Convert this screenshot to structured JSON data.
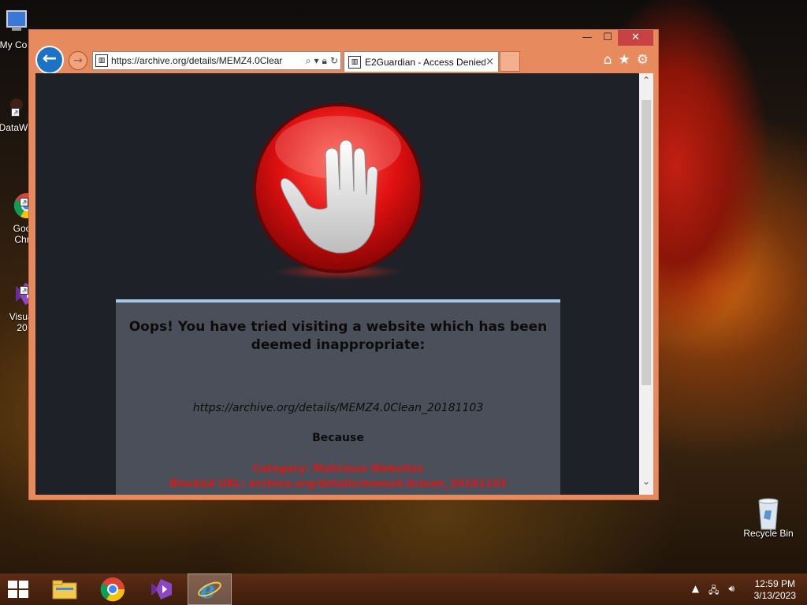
{
  "desktop": {
    "icons": [
      {
        "label": "My Co"
      },
      {
        "label": "DataW"
      },
      {
        "label": "Goo\nChr"
      },
      {
        "label": "Visual\n20"
      },
      {
        "label": "Recycle Bin"
      }
    ]
  },
  "browser": {
    "url": "https://archive.org/details/MEMZ4.0Clear",
    "tab_title": "E2Guardian - Access Denied",
    "tab_close": "×",
    "window_controls": {
      "minimize": "—",
      "maximize": "☐",
      "close": "✕"
    }
  },
  "page": {
    "heading": "Oops! You have tried visiting a website which has been deemed inappropriate:",
    "blocked_url": "https://archive.org/details/MEMZ4.0Clean_20181103",
    "because": "Because",
    "category": "Category: Malicious Websites",
    "blocked_line": "Blocked URL: archive.org/details/memz4.0clean_20181103"
  },
  "taskbar": {
    "time": "12:59 PM",
    "date": "3/13/2023"
  },
  "colors": {
    "ie_blue": "#1c72c4",
    "titlebar": "#e78b5e",
    "page_bg": "#1f2128",
    "panel_bg": "#4a4f5a",
    "alert_red": "#d21b1b"
  }
}
